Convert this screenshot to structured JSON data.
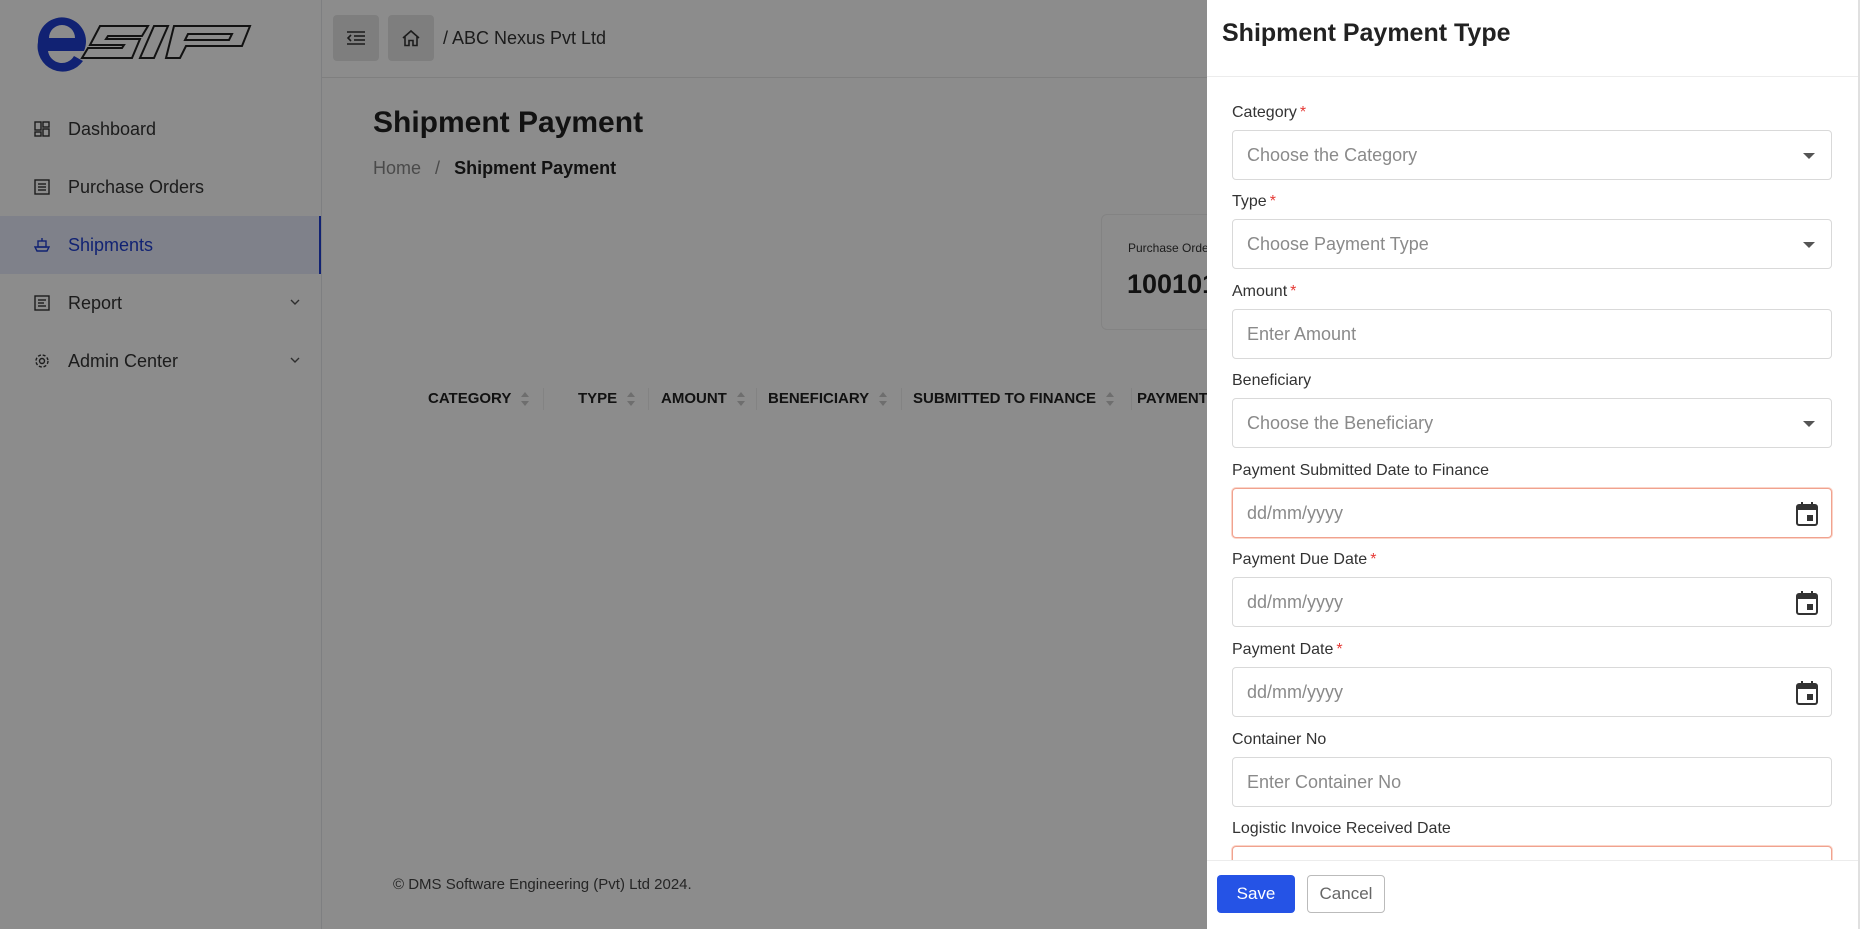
{
  "logo": {
    "text": "esip"
  },
  "sidebar": {
    "items": [
      {
        "label": "Dashboard",
        "icon": "dashboard-icon",
        "active": false
      },
      {
        "label": "Purchase Orders",
        "icon": "list-icon",
        "active": false
      },
      {
        "label": "Shipments",
        "icon": "ship-icon",
        "active": true
      },
      {
        "label": "Report",
        "icon": "report-icon",
        "active": false,
        "expandable": true
      },
      {
        "label": "Admin Center",
        "icon": "gear-icon",
        "active": false,
        "expandable": true
      }
    ]
  },
  "header": {
    "company": "/ ABC Nexus Pvt Ltd"
  },
  "main": {
    "title": "Shipment Payment",
    "breadcrumb": {
      "home": "Home",
      "separator": "/",
      "current": "Shipment Payment"
    },
    "po_card": {
      "label": "Purchase Orde",
      "value": "100101"
    },
    "table": {
      "columns": [
        "CATEGORY",
        "TYPE",
        "AMOUNT",
        "BENEFICIARY",
        "SUBMITTED TO FINANCE",
        "PAYMENT"
      ]
    },
    "footer": "© DMS Software Engineering (Pvt) Ltd 2024."
  },
  "drawer": {
    "title": "Shipment Payment Type",
    "fields": [
      {
        "label": "Category",
        "required": true,
        "kind": "select",
        "placeholder": "Choose the Category"
      },
      {
        "label": "Type",
        "required": true,
        "kind": "select",
        "placeholder": "Choose Payment Type"
      },
      {
        "label": "Amount",
        "required": true,
        "kind": "text",
        "placeholder": "Enter Amount"
      },
      {
        "label": "Beneficiary",
        "required": false,
        "kind": "select",
        "placeholder": "Choose the Beneficiary"
      },
      {
        "label": "Payment Submitted Date to Finance",
        "required": false,
        "kind": "date",
        "placeholder": "dd/mm/yyyy",
        "error": true
      },
      {
        "label": "Payment Due Date",
        "required": true,
        "kind": "date",
        "placeholder": "dd/mm/yyyy"
      },
      {
        "label": "Payment Date",
        "required": true,
        "kind": "date",
        "placeholder": "dd/mm/yyyy"
      },
      {
        "label": "Container No",
        "required": false,
        "kind": "text",
        "placeholder": "Enter Container No"
      },
      {
        "label": "Logistic Invoice Received Date",
        "required": false,
        "kind": "date",
        "placeholder": "",
        "error": true
      }
    ],
    "save_label": "Save",
    "cancel_label": "Cancel",
    "required_mark": "*"
  },
  "colors": {
    "accent": "#1f3fd1",
    "primary_button": "#2553e6",
    "required": "#e53935",
    "overlay": "rgba(0,0,0,0.45)"
  }
}
